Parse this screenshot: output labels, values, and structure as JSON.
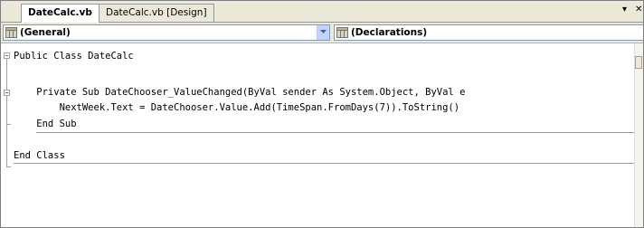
{
  "tabs": [
    {
      "label": "DateCalc.vb",
      "active": true
    },
    {
      "label": "DateCalc.vb [Design]",
      "active": false
    }
  ],
  "tab_controls": {
    "dropdown_glyph": "▾",
    "close_glyph": "✕"
  },
  "navbar": {
    "left_combo": {
      "value": "(General)",
      "icon": "class-icon"
    },
    "right_combo": {
      "value": "(Declarations)",
      "icon": "method-icon"
    }
  },
  "code_lines": [
    "Public Class DateCalc",
    "",
    "    Private Sub DateChooser_ValueChanged(ByVal sender As System.Object, ByVal e",
    "        NextWeek.Text = DateChooser.Value.Add(TimeSpan.FromDays(7)).ToString()",
    "    End Sub",
    "",
    "End Class"
  ],
  "colors": {
    "background": "#ece9d8",
    "editor_bg": "#ffffff",
    "combo_border": "#7f9db9"
  }
}
